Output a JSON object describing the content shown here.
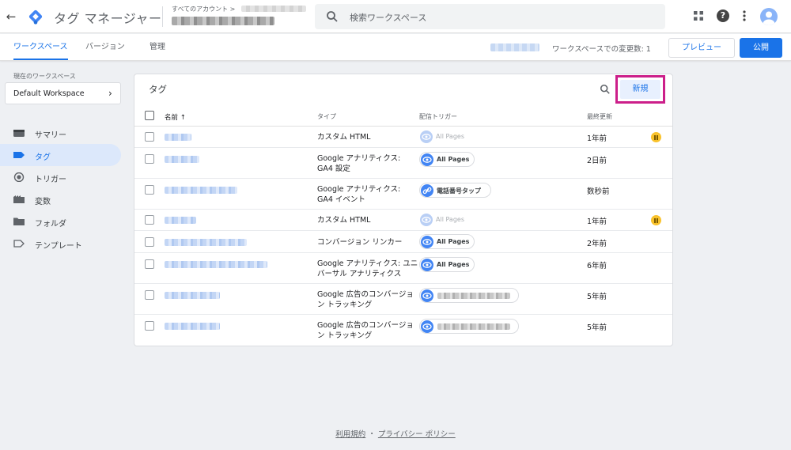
{
  "header": {
    "back_icon": "arrow-back-icon",
    "app_title": "タグ マネージャー",
    "account_label": "すべてのアカウント >",
    "search_placeholder": "検索ワークスペース",
    "brand_color": "#1a73e8"
  },
  "tabs": [
    {
      "label": "ワークスペース",
      "active": true
    },
    {
      "label": "バージョン",
      "active": false
    },
    {
      "label": "管理",
      "active": false
    }
  ],
  "subbar": {
    "changes_label": "ワークスペースでの変更数: 1",
    "preview_label": "プレビュー",
    "publish_label": "公開"
  },
  "sidebar": {
    "current_ws_label": "現在のワークスペース",
    "workspace_name": "Default Workspace",
    "items": [
      {
        "label": "サマリー",
        "icon": "summary-icon",
        "active": false
      },
      {
        "label": "タグ",
        "icon": "tag-icon",
        "active": true
      },
      {
        "label": "トリガー",
        "icon": "trigger-icon",
        "active": false
      },
      {
        "label": "変数",
        "icon": "variables-icon",
        "active": false
      },
      {
        "label": "フォルダ",
        "icon": "folder-icon",
        "active": false
      },
      {
        "label": "テンプレート",
        "icon": "template-icon",
        "active": false
      }
    ]
  },
  "tags_card": {
    "title": "タグ",
    "new_label": "新規",
    "highlight_color": "#cc1f8a",
    "columns": {
      "name": "名前",
      "type": "タイプ",
      "trigger": "配信トリガー",
      "updated": "最終更新"
    },
    "rows": [
      {
        "type": "カスタム HTML",
        "trigger": "All Pages",
        "trigger_muted": true,
        "updated": "1年前",
        "paused": true
      },
      {
        "type": "Google アナリティクス: GA4 設定",
        "trigger": "All Pages",
        "trigger_muted": false,
        "updated": "2日前",
        "paused": false
      },
      {
        "type": "Google アナリティクス: GA4 イベント",
        "trigger": "電話番号タップ",
        "trigger_muted": false,
        "updated": "数秒前",
        "paused": false
      },
      {
        "type": "カスタム HTML",
        "trigger": "All Pages",
        "trigger_muted": true,
        "updated": "1年前",
        "paused": true
      },
      {
        "type": "コンバージョン リンカー",
        "trigger": "All Pages",
        "trigger_muted": false,
        "updated": "2年前",
        "paused": false
      },
      {
        "type": "Google アナリティクス: ユニバーサル アナリティクス",
        "trigger": "All Pages",
        "trigger_muted": false,
        "updated": "6年前",
        "paused": false
      },
      {
        "type": "Google 広告のコンバージョン トラッキング",
        "trigger": "",
        "trigger_muted": false,
        "updated": "5年前",
        "paused": false
      },
      {
        "type": "Google 広告のコンバージョン トラッキング",
        "trigger": "",
        "trigger_muted": false,
        "updated": "5年前",
        "paused": false
      }
    ]
  },
  "footer": {
    "terms": "利用規約",
    "separator": "・",
    "privacy": "プライバシー ポリシー"
  }
}
